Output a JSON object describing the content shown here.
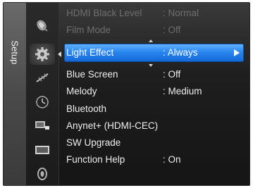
{
  "sidebar": {
    "tab_label": "Setup",
    "icons": [
      "satellite-dish-icon",
      "setup-gear-icon",
      "antenna-icon",
      "clock-icon",
      "input-icon",
      "picture-icon",
      "sound-icon"
    ]
  },
  "menu": {
    "items": [
      {
        "label": "HDMI Black Level",
        "value": ": Normal",
        "state": "disabled"
      },
      {
        "label": "Film Mode",
        "value": ": Off",
        "state": "disabled"
      },
      {
        "label": "Light Effect",
        "value": ": Always",
        "state": "selected"
      },
      {
        "label": "Blue Screen",
        "value": ": Off",
        "state": "normal"
      },
      {
        "label": "Melody",
        "value": ": Medium",
        "state": "normal"
      },
      {
        "label": "Bluetooth",
        "value": "",
        "state": "normal"
      },
      {
        "label": "Anynet+ (HDMI-CEC)",
        "value": "",
        "state": "normal"
      },
      {
        "label": "SW Upgrade",
        "value": "",
        "state": "normal"
      },
      {
        "label": "Function Help",
        "value": ": On",
        "state": "normal"
      }
    ]
  },
  "colors": {
    "selection": "#2a86f0",
    "background": "#1b1b1b",
    "text": "#eeeeee",
    "disabled_text": "#6e6e6e"
  }
}
